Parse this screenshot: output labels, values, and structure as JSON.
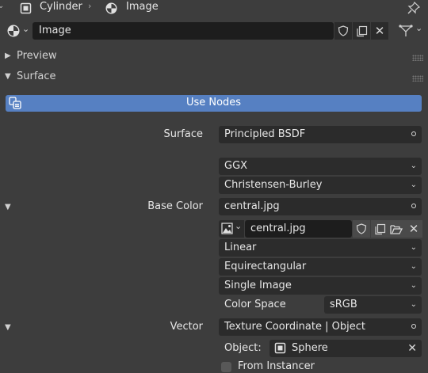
{
  "header": {
    "object_name": "Cylinder",
    "data_name": "Image"
  },
  "material_slot": {
    "name": "Image"
  },
  "panels": {
    "preview": "Preview",
    "surface": "Surface"
  },
  "use_nodes_label": "Use Nodes",
  "props": {
    "surface_label": "Surface",
    "surface_value": "Principled BSDF",
    "distribution": "GGX",
    "subsurface": "Christensen-Burley",
    "base_color_label": "Base Color",
    "base_color_value": "central.jpg",
    "image_name": "central.jpg",
    "interpolation": "Linear",
    "projection": "Equirectangular",
    "source": "Single Image",
    "color_space_label": "Color Space",
    "color_space_value": "sRGB",
    "vector_label": "Vector",
    "vector_value": "Texture Coordinate | Object",
    "object_label": "Object:",
    "object_value": "Sphere",
    "from_instancer_label": "From Instancer"
  },
  "colors": {
    "accent": "#5680c2",
    "background": "#3d3d3d",
    "field": "#2b2b2b"
  }
}
